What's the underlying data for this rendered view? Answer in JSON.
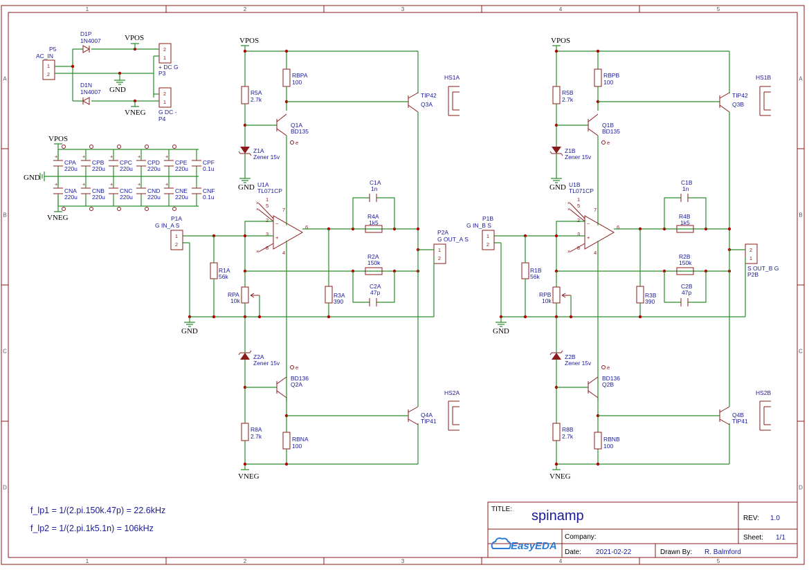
{
  "rulers": {
    "columns": [
      "1",
      "2",
      "3",
      "4",
      "5"
    ],
    "rows": [
      "A",
      "B",
      "C",
      "D"
    ]
  },
  "formulas": {
    "f1": "f_lp1 = 1/(2.pi.150k.47p) = 22.6kHz",
    "f2": "f_lp2 = 1/(2.pi.1k5.1n) = 106kHz"
  },
  "title_block": {
    "title_label": "TITLE:",
    "title": "spinamp",
    "rev_label": "REV:",
    "rev": "1.0",
    "company_label": "Company:",
    "sheet_label": "Sheet:",
    "sheet": "1/1",
    "date_label": "Date:",
    "date": "2021-02-22",
    "drawn_label": "Drawn By:",
    "drawn": "R. Balmford",
    "logo": "EasyEDA"
  },
  "supply": {
    "p5": "P5",
    "p5_name": "AC_IN",
    "d1p": "D1P",
    "d1p_val": "1N4007",
    "d1n": "D1N",
    "d1n_val": "1N4007",
    "vpos": "VPOS",
    "vneg": "VNEG",
    "gnd": "GND",
    "p3": "P3",
    "p3_name": "+ DC G",
    "p4": "P4",
    "p4_name": "G DC -"
  },
  "caps": {
    "vpos": "VPOS",
    "vneg": "VNEG",
    "gnd": "GND",
    "top": [
      {
        "name": "CPA",
        "val": "220u"
      },
      {
        "name": "CPB",
        "val": "220u"
      },
      {
        "name": "CPC",
        "val": "220u"
      },
      {
        "name": "CPD",
        "val": "220u"
      },
      {
        "name": "CPE",
        "val": "220u"
      },
      {
        "name": "CPF",
        "val": "0.1u"
      }
    ],
    "bottom": [
      {
        "name": "CNA",
        "val": "220u"
      },
      {
        "name": "CNB",
        "val": "220u"
      },
      {
        "name": "CNC",
        "val": "220u"
      },
      {
        "name": "CND",
        "val": "220u"
      },
      {
        "name": "CNE",
        "val": "220u"
      },
      {
        "name": "CNF",
        "val": "0.1u"
      }
    ]
  },
  "chA": {
    "vpos": "VPOS",
    "vneg": "VNEG",
    "gnd1": "GND",
    "gnd2": "GND",
    "r5": "R5A",
    "r5v": "2.7k",
    "rbp": "RBPA",
    "rbpv": "100",
    "q1": "Q1A",
    "q1v": "BD135",
    "q3": "Q3A",
    "q3v": "TIP42",
    "hs1": "HS1A",
    "z1": "Z1A",
    "z1v": "Zener 15v",
    "u1": "U1A",
    "u1v": "TL071CP",
    "c1": "C1A",
    "c1v": "1n",
    "r4": "R4A",
    "r4v": "1k5",
    "r2": "R2A",
    "r2v": "150k",
    "c2": "C2A",
    "c2v": "47p",
    "r3": "R3A",
    "r3v": "390",
    "r1": "R1A",
    "r1v": "56k",
    "rp": "RPA",
    "rpv": "10k",
    "p1": "P1A",
    "p1n": "G IN_A S",
    "p2": "P2A",
    "p2n": "G OUT_A S",
    "z2": "Z2A",
    "z2v": "Zener 15v",
    "q2": "Q2A",
    "q2v": "BD136",
    "q4": "Q4A",
    "q4v": "TIP41",
    "hs2": "HS2A",
    "r8": "R8A",
    "r8v": "2.7k",
    "rbn": "RBNA",
    "rbnv": "100"
  },
  "chB": {
    "vpos": "VPOS",
    "vneg": "VNEG",
    "gnd1": "GND",
    "gnd2": "GND",
    "r5": "R5B",
    "r5v": "2.7k",
    "rbp": "RBPB",
    "rbpv": "100",
    "q1": "Q1B",
    "q1v": "BD135",
    "q3": "Q3B",
    "q3v": "TIP42",
    "hs1": "HS1B",
    "z1": "Z1B",
    "z1v": "Zener 15v",
    "u1": "U1B",
    "u1v": "TL071CP",
    "c1": "C1B",
    "c1v": "1n",
    "r4": "R4B",
    "r4v": "1k5",
    "r2": "R2B",
    "r2v": "150k",
    "c2": "C2B",
    "c2v": "47p",
    "r3": "R3B",
    "r3v": "390",
    "r1": "R1B",
    "r1v": "56k",
    "rp": "RPB",
    "rpv": "10k",
    "p1": "P1B",
    "p1n": "G IN_B S",
    "p2": "P2B",
    "p2n": "S OUT_B G",
    "z2": "Z2B",
    "z2v": "Zener 15v",
    "q2": "Q2B",
    "q2v": "BD136",
    "q4": "Q4B",
    "q4v": "TIP41",
    "hs2": "HS2B",
    "r8": "R8B",
    "r8v": "2.7k",
    "rbn": "RBNB",
    "rbnv": "100"
  }
}
